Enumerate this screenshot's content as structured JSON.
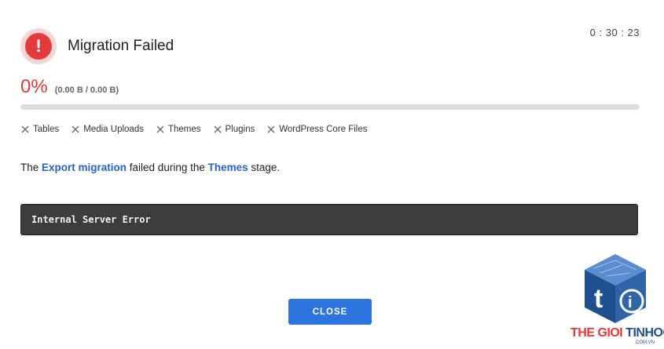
{
  "header": {
    "title": "Migration Failed",
    "status_icon": "alert-icon",
    "status_color": "#e33b3b"
  },
  "timer": "0 : 30 : 23",
  "progress": {
    "percent_label": "0%",
    "size_label": "(0.00 B / 0.00 B)",
    "value": 0
  },
  "stages": [
    {
      "label": "Tables",
      "icon": "x-icon"
    },
    {
      "label": "Media Uploads",
      "icon": "x-icon"
    },
    {
      "label": "Themes",
      "icon": "x-icon"
    },
    {
      "label": "Plugins",
      "icon": "x-icon"
    },
    {
      "label": "WordPress Core Files",
      "icon": "x-icon"
    }
  ],
  "message": {
    "prefix": "The ",
    "migration": "Export migration",
    "middle": " failed during the ",
    "stage": "Themes",
    "suffix": " stage."
  },
  "error": "Internal Server Error",
  "close_label": "CLOSE",
  "watermark": {
    "part1": "THE GIOI ",
    "part2": "TINHOC",
    "domain": ".COM.VN"
  },
  "colors": {
    "accent": "#2c74e0",
    "link": "#2563c4",
    "error": "#e33b3b"
  }
}
